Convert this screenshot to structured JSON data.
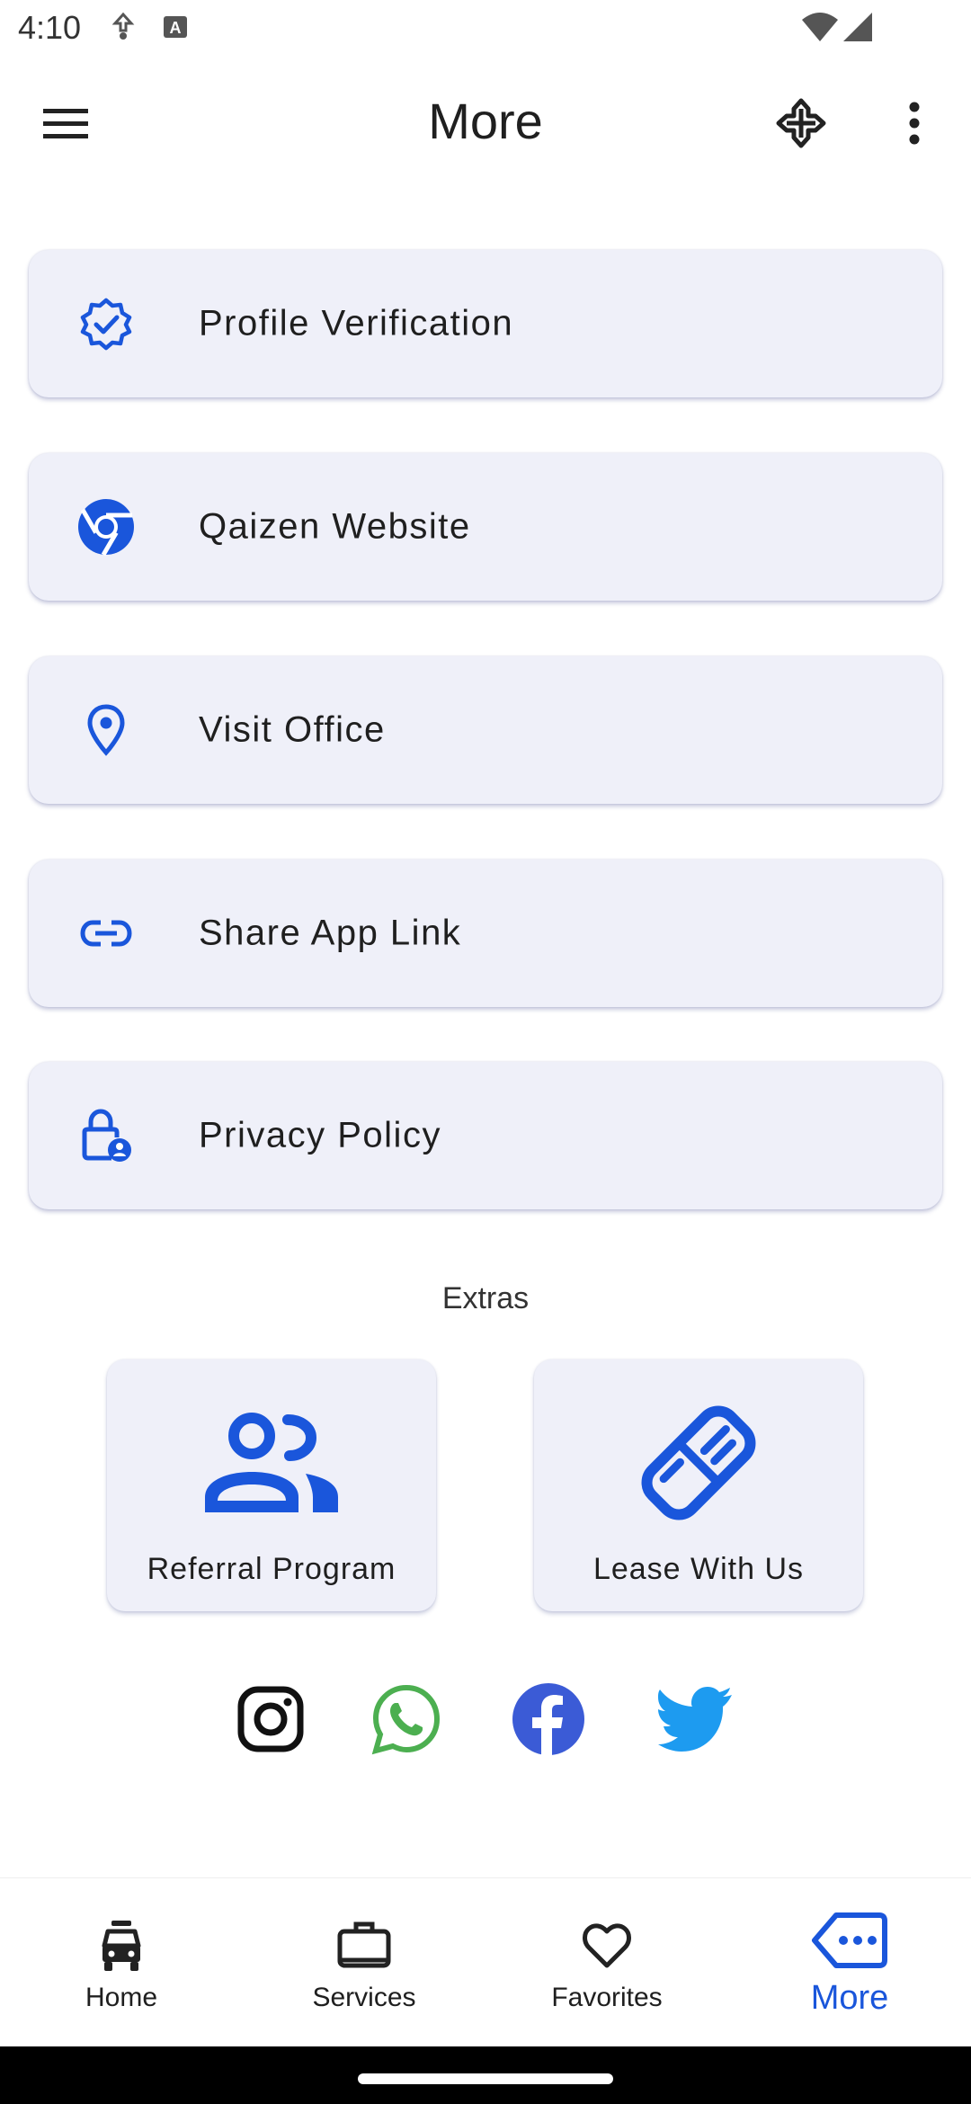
{
  "status": {
    "time": "4:10"
  },
  "appbar": {
    "title": "More"
  },
  "menu_items": [
    {
      "label": "Profile Verification",
      "icon": "verified-badge-icon"
    },
    {
      "label": "Qaizen Website",
      "icon": "chrome-icon"
    },
    {
      "label": "Visit Office",
      "icon": "location-pin-icon"
    },
    {
      "label": "Share App Link",
      "icon": "link-icon"
    },
    {
      "label": "Privacy Policy",
      "icon": "lock-person-icon"
    }
  ],
  "extras": {
    "title": "Extras",
    "items": [
      {
        "label": "Referral Program",
        "icon": "people-icon"
      },
      {
        "label": "Lease With Us",
        "icon": "handshake-icon"
      }
    ]
  },
  "social": [
    "instagram-icon",
    "whatsapp-icon",
    "facebook-icon",
    "twitter-icon"
  ],
  "bottom_nav": [
    {
      "label": "Home",
      "icon": "car-icon"
    },
    {
      "label": "Services",
      "icon": "briefcase-icon"
    },
    {
      "label": "Favorites",
      "icon": "heart-icon"
    },
    {
      "label": "More",
      "icon": "more-chat-icon",
      "active": true
    }
  ],
  "colors": {
    "accent": "#1a56db",
    "card_bg": "#eff0f9",
    "whatsapp": "#4caf50",
    "facebook": "#3b5bd6",
    "twitter": "#1d9bf0"
  }
}
